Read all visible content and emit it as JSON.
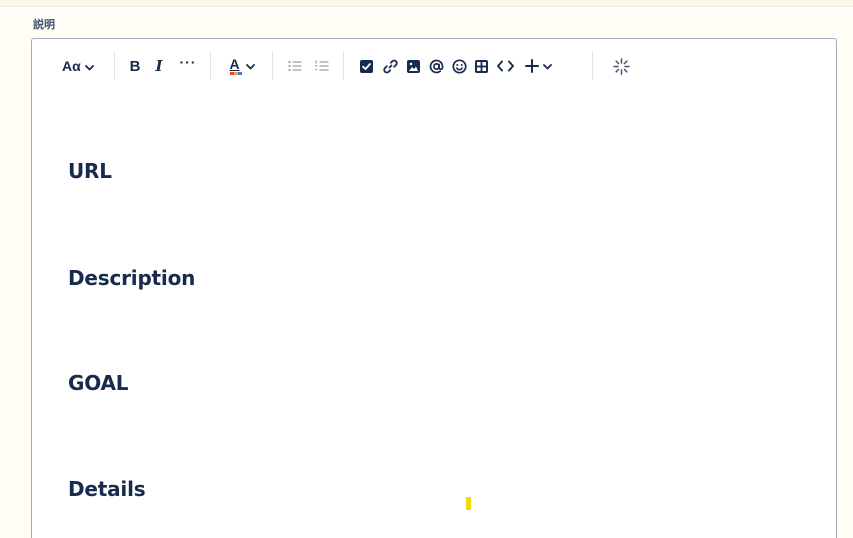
{
  "field": {
    "label": "説明"
  },
  "toolbar": {
    "text_style_label": "Aα",
    "bold_label": "B",
    "italic_label": "I",
    "more_formatting_label": "···",
    "text_color_label": "A",
    "icons": [
      "chevron-down-icon",
      "bullet-list-icon",
      "numbered-list-icon",
      "task-checkbox-icon",
      "link-icon",
      "image-icon",
      "mention-icon",
      "emoji-icon",
      "table-icon",
      "code-icon",
      "insert-plus-icon",
      "ai-sparkle-icon"
    ]
  },
  "content": {
    "headings": [
      "URL",
      "Description",
      "GOAL",
      "Details"
    ]
  },
  "colors": {
    "accent_text": "#172b4d",
    "border": "#a5adba",
    "cursor": "#f4d80a"
  }
}
